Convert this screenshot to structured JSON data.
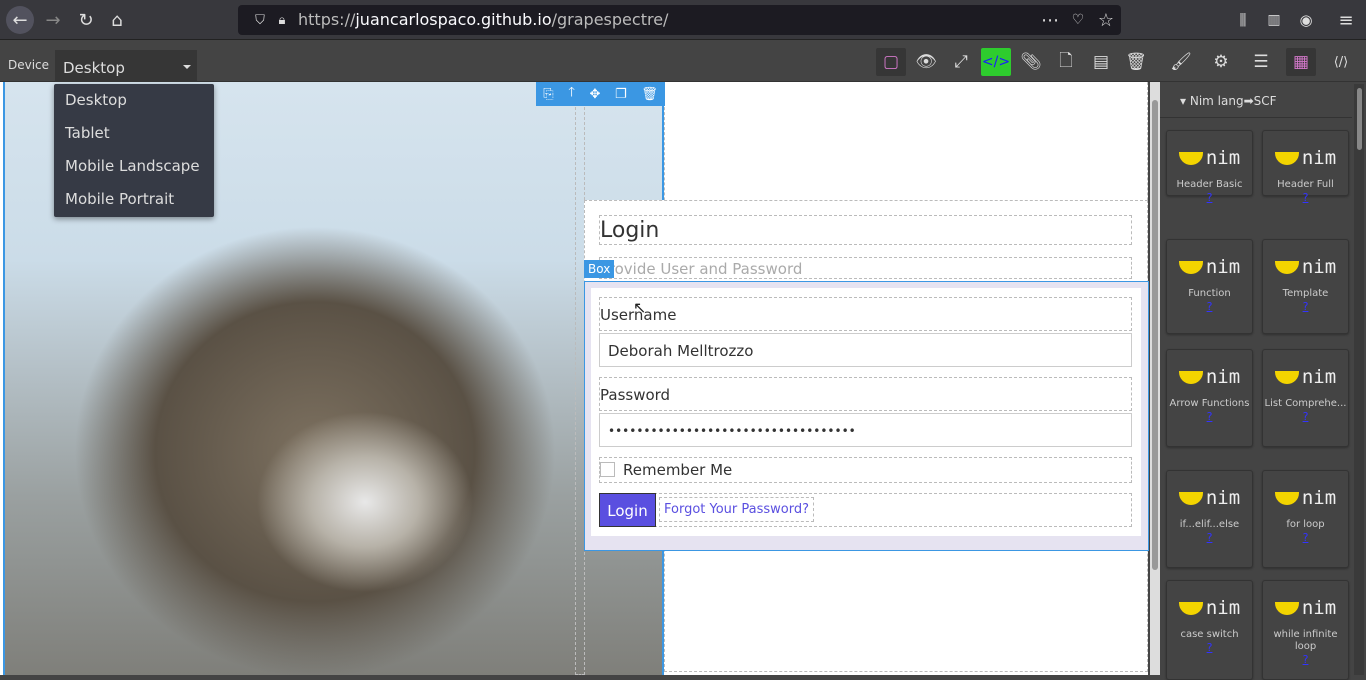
{
  "browser": {
    "url_prefix": "https://",
    "url_host": "juancarlospaco.github.io",
    "url_path": "/grapespectre/"
  },
  "device": {
    "label": "Device",
    "selected": "Desktop",
    "options": [
      "Desktop",
      "Tablet",
      "Mobile Landscape",
      "Mobile Portrait"
    ]
  },
  "login": {
    "title": "Login",
    "subtitle": "Provide User and Password",
    "username_label": "Username",
    "username_value": "Deborah Melltrozzo",
    "password_label": "Password",
    "password_value": "•••••••••••••••••••••••••••••••••••",
    "remember": "Remember Me",
    "login_button": "Login",
    "forgot": "Forgot Your Password?",
    "badge": "Box"
  },
  "panel": {
    "category": "Nim lang➡SCF",
    "blocks": [
      {
        "name": "Header Basic"
      },
      {
        "name": "Header Full"
      },
      {
        "name": "Function"
      },
      {
        "name": "Template"
      },
      {
        "name": "Arrow Functions"
      },
      {
        "name": "List Comprehe..."
      },
      {
        "name": "if...elif...else"
      },
      {
        "name": "for loop"
      },
      {
        "name": "case switch"
      },
      {
        "name": "while infinite loop"
      }
    ],
    "help": "?",
    "logo_text": "nim"
  },
  "colors": {
    "accent": "#3b97e3",
    "code_active": "#2ecc2e",
    "login_button": "#5a4fe0"
  }
}
